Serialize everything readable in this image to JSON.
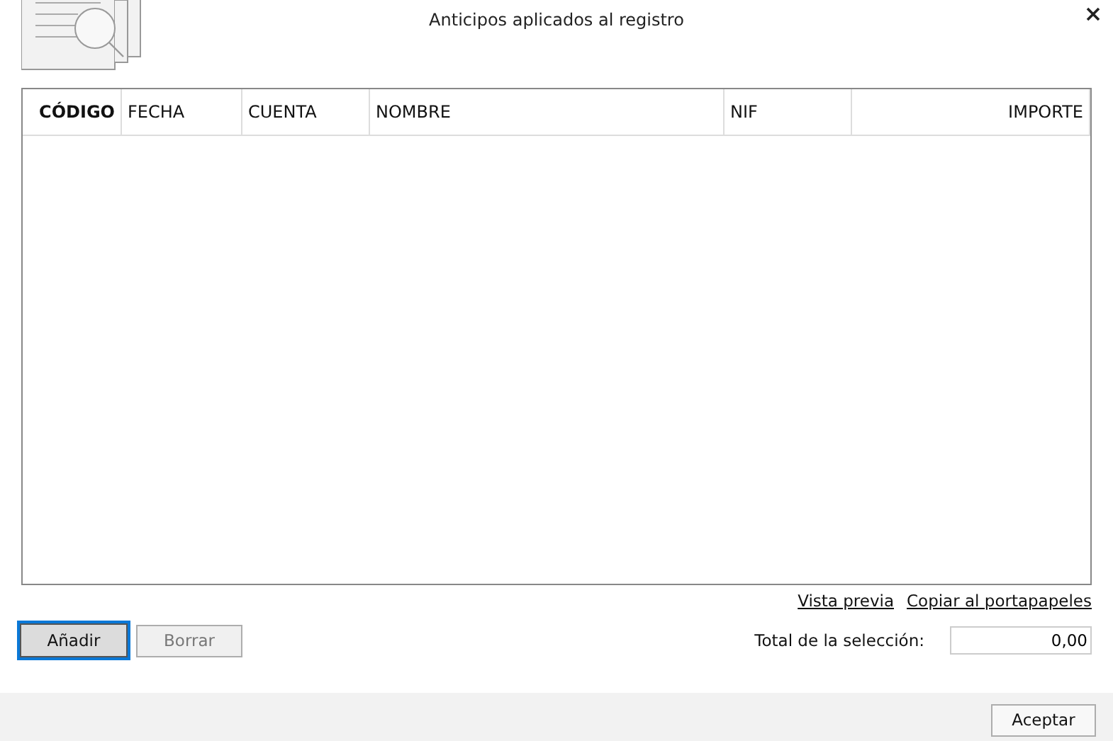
{
  "window": {
    "title": "Anticipos aplicados al registro"
  },
  "table": {
    "columns": [
      {
        "label": "CÓDIGO",
        "sorted": true
      },
      {
        "label": "FECHA",
        "sorted": false
      },
      {
        "label": "CUENTA",
        "sorted": false
      },
      {
        "label": "NOMBRE",
        "sorted": false
      },
      {
        "label": "NIF",
        "sorted": false
      },
      {
        "label": "IMPORTE",
        "sorted": false
      }
    ]
  },
  "links": [
    "Vista previa",
    "Copiar al portapapeles"
  ],
  "buttons": [
    {
      "label": "Añadir",
      "focused": true,
      "disabled": false
    },
    {
      "label": "Borrar",
      "focused": false,
      "disabled": true
    }
  ],
  "total": {
    "label": "Total de la selección:",
    "value": "0,00"
  },
  "footer_button": "Aceptar"
}
